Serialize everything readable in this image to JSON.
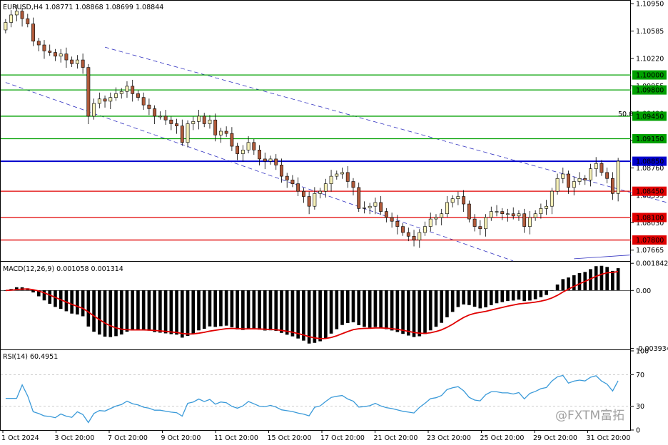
{
  "colors": {
    "bull": "#f5f0b8",
    "bear": "#b05a3a",
    "support_line": "#00a000",
    "resistance_line": "#e00000",
    "key_line": "#0000cc",
    "channel": "#3030c0",
    "macd_hist": "#000000",
    "macd_signal": "#e00000",
    "rsi": "#3a9ad9"
  },
  "chart_data": [
    {
      "type": "candlestick",
      "title": "EURUSD,H4  1.08771 1.08868 1.08699 1.08844",
      "symbol": "EURUSD",
      "timeframe": "H4",
      "ohlc_last": {
        "open": 1.08771,
        "high": 1.08868,
        "low": 1.08699,
        "close": 1.08844
      },
      "ylim": [
        1.0752,
        1.1098
      ],
      "yticks": [
        "1.10950",
        "1.10585",
        "1.10220",
        "1.09855",
        "1.09490",
        "1.09125",
        "1.08760",
        "1.08395",
        "1.08030",
        "1.07665"
      ],
      "xticks": [
        "1 Oct 2024",
        "3 Oct 20:00",
        "7 Oct 20:00",
        "9 Oct 20:00",
        "11 Oct 20:00",
        "15 Oct 20:00",
        "17 Oct 20:00",
        "21 Oct 20:00",
        "23 Oct 20:00",
        "25 Oct 20:00",
        "29 Oct 20:00",
        "31 Oct 20:00"
      ],
      "levels": [
        {
          "value": 1.1,
          "label": "1.10000",
          "kind": "support"
        },
        {
          "value": 1.098,
          "label": "1.09800",
          "kind": "support"
        },
        {
          "value": 1.0945,
          "label": "1.09450",
          "kind": "support"
        },
        {
          "value": 1.0915,
          "label": "1.09150",
          "kind": "support"
        },
        {
          "value": 1.0885,
          "label": "1.08850",
          "kind": "key"
        },
        {
          "value": 1.0845,
          "label": "1.08450",
          "kind": "resistance"
        },
        {
          "value": 1.081,
          "label": "1.08100",
          "kind": "resistance"
        },
        {
          "value": 1.078,
          "label": "1.07800",
          "kind": "resistance"
        }
      ],
      "fib_label": "50.0",
      "closes": [
        1.107,
        1.108,
        1.1085,
        1.1075,
        1.1068,
        1.1045,
        1.104,
        1.1032,
        1.103,
        1.1025,
        1.1028,
        1.102,
        1.1015,
        1.102,
        1.101,
        1.0945,
        1.0962,
        1.0968,
        1.0965,
        1.097,
        1.0975,
        1.0978,
        1.0985,
        1.0975,
        1.097,
        1.096,
        1.0955,
        1.0945,
        1.0945,
        1.094,
        1.0935,
        1.0932,
        1.091,
        1.0935,
        1.0938,
        1.0945,
        1.0935,
        1.094,
        1.092,
        1.0925,
        1.0922,
        1.0905,
        1.0895,
        1.09,
        1.091,
        1.09,
        1.0888,
        1.0885,
        1.0888,
        1.088,
        1.0865,
        1.086,
        1.0855,
        1.0845,
        1.0838,
        1.0825,
        1.0842,
        1.0845,
        1.0855,
        1.0865,
        1.0868,
        1.087,
        1.0858,
        1.085,
        1.0822,
        1.0823,
        1.0825,
        1.083,
        1.0818,
        1.081,
        1.0805,
        1.0798,
        1.079,
        1.0785,
        1.078,
        1.079,
        1.0798,
        1.0808,
        1.081,
        1.0815,
        1.083,
        1.0835,
        1.0838,
        1.0828,
        1.0808,
        1.0798,
        1.0795,
        1.081,
        1.0818,
        1.0818,
        1.0815,
        1.0815,
        1.0812,
        1.0815,
        1.0798,
        1.081,
        1.0815,
        1.0822,
        1.0825,
        1.0845,
        1.0862,
        1.0868,
        1.085,
        1.0858,
        1.0862,
        1.086,
        1.0875,
        1.0882,
        1.087,
        1.0862,
        1.0842,
        1.0885
      ],
      "annotations": [
        "@FXTM富拓"
      ]
    },
    {
      "type": "bar",
      "title": "MACD(12,26,9) 0.001058 0.001314",
      "indicator": "MACD(12,26,9)",
      "macd_value": 0.001058,
      "signal_value": 0.001314,
      "ylim": [
        -0.004,
        0.0019
      ],
      "yticks": [
        "0.001842",
        "0.00",
        "-0.003934"
      ]
    },
    {
      "type": "line",
      "title": "RSI(14) 60.4951",
      "indicator": "RSI(14)",
      "value": 60.4951,
      "ylim": [
        0,
        100
      ],
      "yticks": [
        "100",
        "70",
        "30",
        "0"
      ]
    }
  ]
}
